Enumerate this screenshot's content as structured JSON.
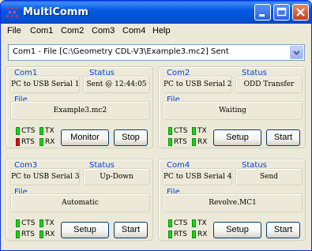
{
  "window": {
    "title": "MultiComm"
  },
  "menu": [
    "File",
    "Com1",
    "Com2",
    "Com3",
    "Com4",
    "Help"
  ],
  "combo": {
    "value": "Com1 - File [C:\\Geometry CDL-V3\\Example3.mc2] Sent"
  },
  "ports": [
    {
      "port_label": "Com1",
      "status_label": "Status",
      "file_label": "File",
      "port_name": "PC to USB Serial 1",
      "status": "Sent @ 12:44:05",
      "file": "Example3.mc2",
      "cts": "CTS",
      "tx": "TX",
      "rts": "RTS",
      "rx": "RX",
      "cts_on": true,
      "tx_on": true,
      "rts_on": false,
      "rx_on": true,
      "btn1": "Monitor",
      "btn2": "Stop"
    },
    {
      "port_label": "Com2",
      "status_label": "Status",
      "file_label": "File",
      "port_name": "PC to USB Serial 2",
      "status": "ODD Transfer",
      "file": "Waiting",
      "cts": "CTS",
      "tx": "TX",
      "rts": "RTS",
      "rx": "RX",
      "cts_on": true,
      "tx_on": true,
      "rts_on": true,
      "rx_on": true,
      "btn1": "Setup",
      "btn2": "Start"
    },
    {
      "port_label": "Com3",
      "status_label": "Status",
      "file_label": "File",
      "port_name": "PC to USB Serial 3",
      "status": "Up-Down",
      "file": "Automatic",
      "cts": "CTS",
      "tx": "TX",
      "rts": "RTS",
      "rx": "RX",
      "cts_on": true,
      "tx_on": true,
      "rts_on": true,
      "rx_on": true,
      "btn1": "Setup",
      "btn2": "Start"
    },
    {
      "port_label": "Com4",
      "status_label": "Status",
      "file_label": "File",
      "port_name": "PC to USB Serial 4",
      "status": "Send",
      "file": "Revolve.MC1",
      "cts": "CTS",
      "tx": "TX",
      "rts": "RTS",
      "rx": "RX",
      "cts_on": true,
      "tx_on": true,
      "rts_on": true,
      "rx_on": true,
      "btn1": "Setup",
      "btn2": "Start"
    }
  ],
  "colors": {
    "titlebar": "#0458e1",
    "accent_label": "#0046d5",
    "led_on": "#16d716",
    "led_off": "#d41616"
  },
  "icons": [
    "app-icon",
    "minimize-icon",
    "maximize-icon",
    "close-icon",
    "dropdown-arrow-icon"
  ]
}
